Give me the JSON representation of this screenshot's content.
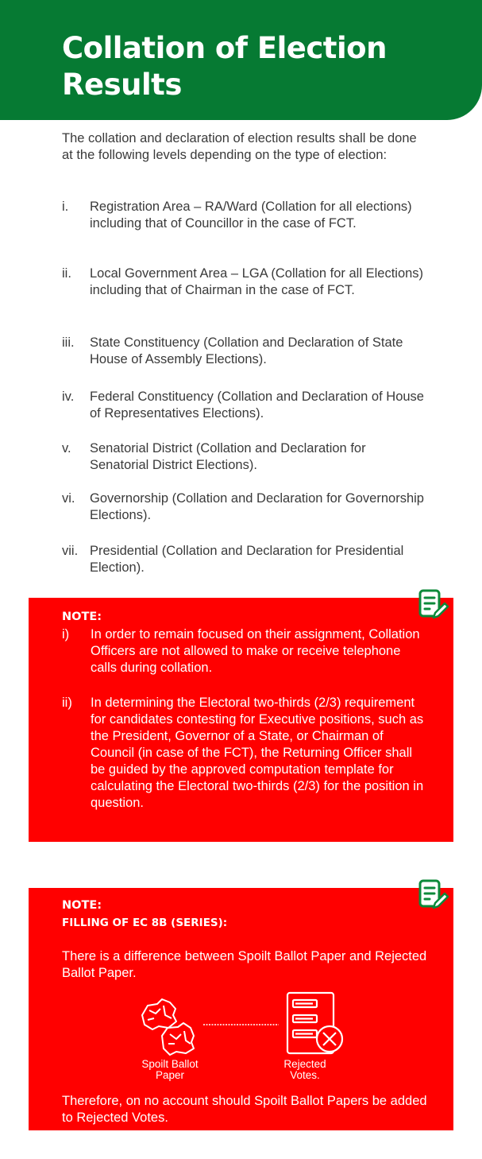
{
  "page": {
    "title": "Collation of Election Results",
    "intro": "The collation and declaration of election results shall be done at the following levels depending on the type of election:"
  },
  "levels": [
    {
      "num": "i.",
      "text": "Registration Area – RA/Ward (Collation for all elections) including that of Councillor in the case of FCT."
    },
    {
      "num": "ii.",
      "text": "Local Government Area – LGA (Collation for all Elections) including that of Chairman in the case of FCT."
    },
    {
      "num": "iii.",
      "text": "State Constituency (Collation and Declaration of State House of Assembly Elections)."
    },
    {
      "num": "iv.",
      "text": "Federal Constituency (Collation and Declaration of House of Representatives Elections)."
    },
    {
      "num": "v.",
      "text": "Senatorial District (Collation and Declaration for Senatorial District Elections)."
    },
    {
      "num": "vi.",
      "text": "Governorship (Collation and Declaration for Governorship Elections)."
    },
    {
      "num": "vii.",
      "text": "Presidential (Collation and Declaration for Presidential Election)."
    }
  ],
  "note1": {
    "title": "NOTE:",
    "icon": "note-edit-icon",
    "items": [
      {
        "num": "i)",
        "text": "In order to remain focused on their assignment, Collation Officers are not allowed to make or receive telephone calls during collation."
      },
      {
        "num": "ii)",
        "text": "In determining the Electoral two-thirds (2/3) requirement for candidates contesting for Executive positions, such as the President, Governor of a State, or Chairman of Council (in case of the FCT), the Returning Officer shall be guided by the approved computation template for calculating the Electoral two-thirds (2/3) for the position in question."
      }
    ]
  },
  "note2": {
    "title": "NOTE:",
    "subtitle": "FILLING OF EC 8B (SERIES):",
    "icon": "note-edit-icon",
    "text1": "There is a difference between Spoilt Ballot Paper and Rejected Ballot Paper.",
    "spoilt_label": "Spoilt Ballot Paper",
    "rejected_label": "Rejected Votes.",
    "text2": "Therefore, on no account should Spoilt Ballot Papers be added to Rejected Votes."
  },
  "colors": {
    "header_green": "#067a33",
    "note_red": "#ff0000",
    "icon_green": "#0c8a3a"
  }
}
